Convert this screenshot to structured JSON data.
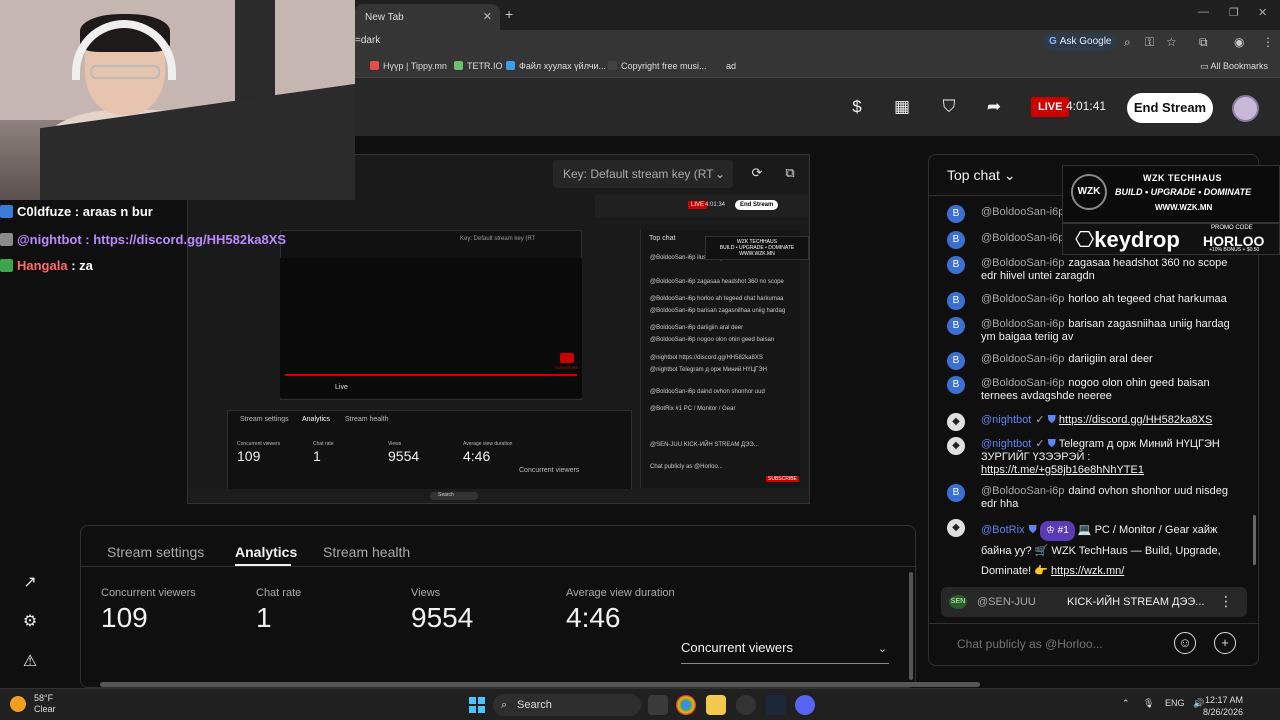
{
  "browser": {
    "tab_title": "New Tab",
    "url_fragment": "=dark",
    "ask_google": "Ask Google",
    "bookmarks": [
      {
        "label": "Нүүр | Tippy.mn",
        "color": "#e84a4a"
      },
      {
        "label": "TETR.IO",
        "color": "#6ec16e"
      },
      {
        "label": "Файл хуулах үйлчи...",
        "color": "#3aa0e6"
      },
      {
        "label": "Copyright free musi...",
        "color": "#444444"
      },
      {
        "label": "ad",
        "color": ""
      }
    ],
    "all_bookmarks": "All Bookmarks"
  },
  "header": {
    "live_label": "LIVE",
    "live_time": "4:01:41",
    "end_stream_label": "End Stream"
  },
  "preview": {
    "stream_key_placeholder": "Key: Default stream key (RT",
    "mini": {
      "live_label": "LIVE",
      "live_time": "4:01:34",
      "end_stream": "End Stream",
      "key": "Key: Default stream key (RT",
      "live_tag": "Live",
      "tabs": [
        "Stream settings",
        "Analytics",
        "Stream health"
      ],
      "labels": [
        "Concurrent viewers",
        "Chat rate",
        "Views",
        "Average view duration"
      ],
      "values": [
        "109",
        "1",
        "9554",
        "4:46"
      ],
      "select": "Concurrent viewers",
      "top_chat": "Top chat",
      "chat_lines": [
        "@BoldooSan-i6p  ilus shonj bolko",
        "@BoldooSan-i6p  zagasaa headshot 360 no scope",
        "@BoldooSan-i6p  horloo ah tegeed chat harkumaa",
        "@BoldooSan-i6p  barisan zagasnilhaa uniig hardag",
        "@BoldooSan-i6p  dariigiin aral deer",
        "@BoldooSan-i6p  nogoo olon ohin geed baisan",
        "@nightbot  https://discord.gg/HH582ka8XS",
        "@nightbot  Telegram д орж Миний НҮЦГЭН",
        "@BoldooSan-i6p  daind ovhon shonhor uud",
        "@BotRix  #1  PC / Monitor / Gear",
        "@SEN-JUU  KICK-ИЙН STREAM ДЭЭ..."
      ],
      "chat_placeholder": "Chat publicly as @Horloo...",
      "wzk1": "WZK TECHHAUS",
      "wzk2": "BUILD • UPGRADE • DOMINATE",
      "wzk3": "WWW.WZK.MN",
      "taskbar_search": "Search",
      "subscribe": "SUBSCRIBE",
      "ovl_lines": [
        "C0ldfuze : araas n bur",
        "@nightbot : https://discord.gg/HH582ka8XS",
        "Hangala : za"
      ]
    }
  },
  "overlay_chat": [
    {
      "name": "C0ldfuze",
      "sep": " : ",
      "msg": "araas n bur",
      "name_color": "white",
      "icon_color": "#3a7bd5"
    },
    {
      "name": "@nightbot",
      "sep": " : ",
      "msg": "https://discord.gg/HH582ka8XS",
      "name_color": "purple",
      "icon_color": "#8a8a8a"
    },
    {
      "name": "Hangala",
      "sep": " : ",
      "msg": "za",
      "name_color": "red",
      "icon_color": "#3fa34d"
    }
  ],
  "analytics": {
    "tabs": [
      "Stream settings",
      "Analytics",
      "Stream health"
    ],
    "active_tab": "Analytics",
    "stats": [
      {
        "label": "Concurrent viewers",
        "value": "109"
      },
      {
        "label": "Chat rate",
        "value": "1"
      },
      {
        "label": "Views",
        "value": "9554"
      },
      {
        "label": "Average view duration",
        "value": "4:46"
      }
    ],
    "metric_select": "Concurrent viewers"
  },
  "chat": {
    "title": "Top chat",
    "messages": [
      {
        "author": "@BoldooSan-i6p",
        "text": ""
      },
      {
        "author": "@BoldooSan-i6p",
        "text": ""
      },
      {
        "author": "@BoldooSan-i6p",
        "text": "zagasaa headshot 360 no scope edr hiivel untei zaragdn"
      },
      {
        "author": "@BoldooSan-i6p",
        "text": "horloo ah tegeed chat harkumaa"
      },
      {
        "author": "@BoldooSan-i6p",
        "text": "barisan zagasniihaa uniig hardag ym baigaa teriig av"
      },
      {
        "author": "@BoldooSan-i6p",
        "text": "dariigiin aral deer"
      },
      {
        "author": "@BoldooSan-i6p",
        "text": "nogoo olon ohin geed baisan ternees avdagshde neeree"
      },
      {
        "author": "@nightbot",
        "text": "https://discord.gg/HH582ka8XS"
      },
      {
        "author": "@nightbot",
        "text_a": "Telegram д орж Миний НҮЦГЭН ЗУРГИЙГ ҮЗЭЭРЭЙ : ",
        "link": "https://t.me/+g58jb16e8hNhYTE1"
      },
      {
        "author": "@BoldooSan-i6p",
        "text": "daind ovhon shonhor uud nisdeg edr hha"
      },
      {
        "author": "@BotRix",
        "badge": "#1",
        "text_a": "PC / Monitor / Gear хайж байна уу?",
        "text_b": "WZK TechHaus — Build, Upgrade, Dominate!",
        "link": "https://wzk.mn/"
      }
    ],
    "pinned": {
      "author": "@SEN-JUU",
      "text": "KICK-ИЙН STREAM ДЭЭ...",
      "icon": "SEN"
    },
    "input_placeholder": "Chat publicly as @Horloo..."
  },
  "sponsor": {
    "logo": "WZK",
    "line1": "WZK TECHHAUS",
    "line2": "BUILD • UPGRADE • DOMINATE",
    "line3": "WWW.WZK.MN",
    "keydrop": "keydrop",
    "promo_label": "PROMO CODE",
    "promo_code": "HORLOO",
    "promo_bonus": "+10% BONUS + $0.50"
  },
  "taskbar": {
    "temp": "58°F",
    "weather": "Clear",
    "search": "Search",
    "lang": "ENG",
    "time": "12:17 AM",
    "date": "8/26/2026"
  }
}
